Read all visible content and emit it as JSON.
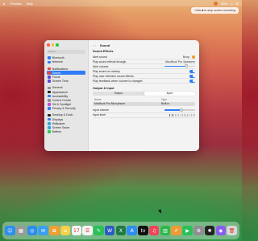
{
  "menubar": {
    "app_name": "Preview",
    "menu": [
      "Help"
    ],
    "battery": "83%",
    "recording_tip": "Click ■ to stop screen recording"
  },
  "window": {
    "title": "Sound",
    "sidebar": {
      "search_placeholder": "Search",
      "items": [
        {
          "label": "Bluetooth",
          "color": "#2f7cf6"
        },
        {
          "label": "Network",
          "color": "#2f7cf6"
        },
        {
          "label": "Notifications",
          "color": "#e5443b"
        },
        {
          "label": "Sound",
          "color": "#e5443b",
          "active": true
        },
        {
          "label": "Focus",
          "color": "#5b4bd6"
        },
        {
          "label": "Screen Time",
          "color": "#5b4bd6"
        },
        {
          "label": "General",
          "color": "#8e8e93"
        },
        {
          "label": "Appearance",
          "color": "#222222"
        },
        {
          "label": "Accessibility",
          "color": "#2f7cf6"
        },
        {
          "label": "Control Centre",
          "color": "#8e8e93"
        },
        {
          "label": "Siri & Spotlight",
          "color": "#c04bd6"
        },
        {
          "label": "Privacy & Security",
          "color": "#2f7cf6"
        },
        {
          "label": "Desktop & Dock",
          "color": "#222222"
        },
        {
          "label": "Displays",
          "color": "#2f7cf6"
        },
        {
          "label": "Wallpaper",
          "color": "#2fa9e0"
        },
        {
          "label": "Screen Saver",
          "color": "#2fa9e0"
        },
        {
          "label": "Battery",
          "color": "#34c759"
        }
      ]
    },
    "sound_effects": {
      "heading": "Sound Effects",
      "alert_sound_label": "Alert sound",
      "alert_sound_value": "Boop",
      "play_through_label": "Play sound effects through",
      "play_through_value": "MacBook Pro Speakers",
      "alert_volume_label": "Alert volume",
      "alert_volume": 0.7,
      "startup_label": "Play sound on startup",
      "ui_effects_label": "Play user interface sound effects",
      "feedback_label": "Play feedback when volume is changed"
    },
    "output_input": {
      "heading": "Output & Input",
      "tabs": [
        "Output",
        "Input"
      ],
      "selected_tab": "Input",
      "col_name": "Name",
      "col_type": "Type",
      "device_name": "MacBook Pro Microphone",
      "device_type": "Built-in",
      "input_volume_label": "Input volume",
      "input_volume": 0.55,
      "input_level_label": "Input level"
    }
  },
  "dock": {
    "icons": [
      {
        "name": "finder-icon",
        "color": "#2f8cf0",
        "glyph": "☺"
      },
      {
        "name": "launchpad-icon",
        "color": "#9a9a9a",
        "glyph": "▦"
      },
      {
        "name": "safari-icon",
        "color": "#2f8cf0",
        "glyph": "◎"
      },
      {
        "name": "mail-icon",
        "color": "#3aa0f0",
        "glyph": "✉"
      },
      {
        "name": "photos-icon",
        "color": "#f0a030",
        "glyph": "✿"
      },
      {
        "name": "notes-icon",
        "color": "#f3d24a",
        "glyph": "≡"
      },
      {
        "name": "calendar-icon",
        "color": "#f4f4f4",
        "glyph": "17"
      },
      {
        "name": "reminders-icon",
        "color": "#f4f4f4",
        "glyph": "☰"
      },
      {
        "name": "messages-icon",
        "color": "#2ac158",
        "glyph": "✎"
      },
      {
        "name": "word-icon",
        "color": "#2b5bc3",
        "glyph": "W"
      },
      {
        "name": "excel-icon",
        "color": "#1f7a44",
        "glyph": "X"
      },
      {
        "name": "app-store-icon",
        "color": "#2f8cf0",
        "glyph": "A"
      },
      {
        "name": "apple-tv-icon",
        "color": "#111111",
        "glyph": "tv"
      },
      {
        "name": "music-icon",
        "color": "#f0445a",
        "glyph": "♫"
      },
      {
        "name": "numbers-icon",
        "color": "#2fb84a",
        "glyph": "▥"
      },
      {
        "name": "pages-icon",
        "color": "#f09a30",
        "glyph": "✐"
      },
      {
        "name": "facetime-icon",
        "color": "#2ac158",
        "glyph": "▶"
      },
      {
        "name": "system-settings-icon",
        "color": "#8e8e93",
        "glyph": "⚙"
      },
      {
        "name": "chatgpt-icon",
        "color": "#222222",
        "glyph": "✺"
      },
      {
        "name": "app-icon",
        "color": "#8a5cf0",
        "glyph": "◆"
      },
      {
        "name": "trash-icon",
        "color": "#d8d8d8",
        "glyph": "🗑"
      }
    ]
  }
}
